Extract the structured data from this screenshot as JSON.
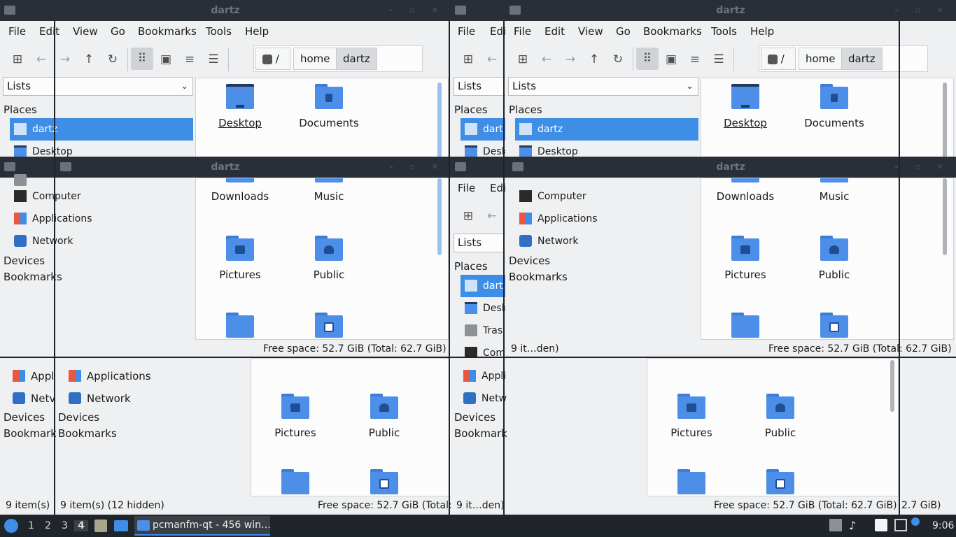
{
  "window_title": "dartz",
  "menu": [
    "File",
    "Edit",
    "View",
    "Go",
    "Bookmarks",
    "Tools",
    "Help"
  ],
  "menu_short": {
    "file": "File",
    "edit": "Edi"
  },
  "side_selector": "Lists",
  "places_heading": "Places",
  "devices_heading": "Devices",
  "bookmarks_heading": "Bookmarks",
  "places": {
    "home": "dartz",
    "home_short": "dart",
    "desktop": "Desktop",
    "desktop_short": "Desk",
    "trash": "Trash",
    "trash_short": "Tras",
    "computer": "Computer",
    "computer_short": "Com",
    "applications": "Applications",
    "applications_short": "Appl",
    "network": "Network",
    "network_short": "Netv",
    "bookmarks_short": "Bookmarks",
    "bookmarks_short2": "Bookmark"
  },
  "path": {
    "root": "/",
    "home": "home",
    "user": "dartz"
  },
  "folders": {
    "desktop": "Desktop",
    "documents": "Documents",
    "downloads": "Downloads",
    "music": "Music",
    "pictures": "Pictures",
    "public": "Public"
  },
  "status": {
    "items": "9 item(s) (12 hidden)",
    "items_short": "9 item(s)",
    "items_ellipsis": "9 it…den)",
    "free": "Free space: 52.7 GiB (Total: 62.7 GiB)",
    "free_cut": "Free space: 52.7 GiB (Total: 6",
    "free_tail": "2.7 GiB)"
  },
  "taskbar": {
    "workspaces": [
      "1",
      "2",
      "3",
      "4"
    ],
    "active_workspace": "4",
    "task_label": "pcmanfm-qt - 456 win…",
    "clock": "9:06"
  },
  "colors": {
    "accent": "#3e8de6",
    "folder": "#4c8ee8",
    "titlebar": "#2a2f37",
    "panel": "#1f252b"
  }
}
